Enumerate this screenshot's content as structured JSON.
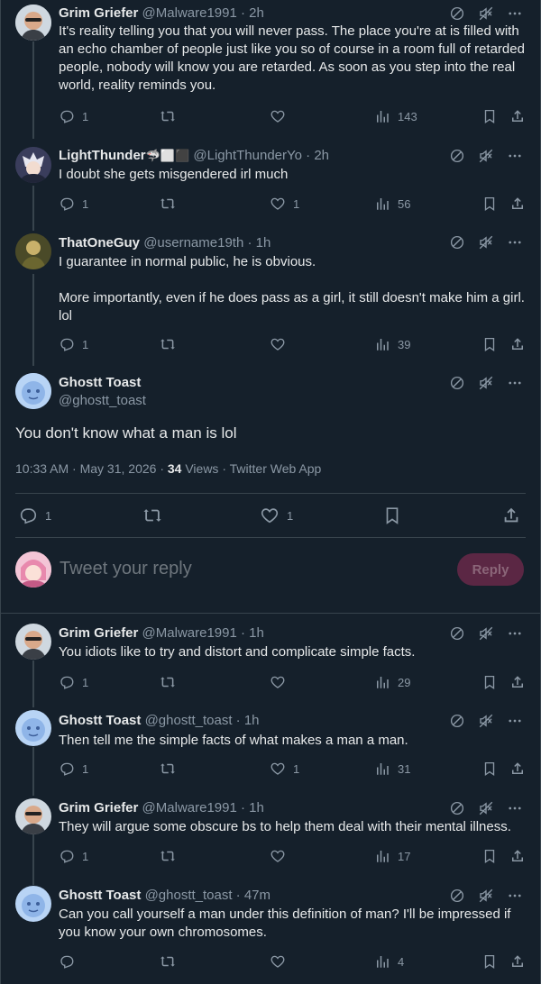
{
  "tweets_above": [
    {
      "name": "Grim Griefer",
      "handle": "@Malware1991 · 2h",
      "text": "It's reality telling you that you will never pass. The place you're at is filled with an echo chamber of people just like you so of course in a room full of retarded people, nobody will know you are retarded. As soon as you step into the real world, reality reminds you.",
      "replies": "1",
      "likes": "",
      "views": "143"
    },
    {
      "name": "LightThunder",
      "name_suffix": "🦈⬜⬛",
      "handle": "@LightThunderYo · 2h",
      "text": "I doubt she gets misgendered irl much",
      "replies": "1",
      "likes": "1",
      "views": "56"
    },
    {
      "name": "ThatOneGuy",
      "handle": "@username19th · 1h",
      "text": "I guarantee in normal public, he is obvious.\n\nMore importantly, even if he does pass as a girl, it still doesn't make him a girl. lol",
      "replies": "1",
      "likes": "",
      "views": "39"
    }
  ],
  "main_tweet": {
    "name": "Ghostt Toast",
    "handle": "@ghostt_toast",
    "text": "You don't know what a man is lol",
    "meta_prefix": "10:33 AM · May 31, 2026 · ",
    "views_count": "34",
    "meta_suffix": " Views · Twitter Web App",
    "replies": "1",
    "likes": "1"
  },
  "reply_composer": {
    "placeholder": "Tweet your reply",
    "button_label": "Reply"
  },
  "tweets_below": [
    {
      "name": "Grim Griefer",
      "handle": "@Malware1991 · 1h",
      "text": "You idiots like to try and distort and complicate simple facts.",
      "replies": "1",
      "likes": "",
      "views": "29"
    },
    {
      "name": "Ghostt Toast",
      "handle": "@ghostt_toast · 1h",
      "text": "Then tell me the simple facts of what makes a man a man.",
      "replies": "1",
      "likes": "1",
      "views": "31"
    },
    {
      "name": "Grim Griefer",
      "handle": "@Malware1991 · 1h",
      "text": "They will argue some obscure bs to help them deal with their mental illness.",
      "replies": "1",
      "likes": "",
      "views": "17"
    },
    {
      "name": "Ghostt Toast",
      "handle": "@ghostt_toast · 47m",
      "text": "Can you call yourself a man under this definition of man? I'll be impressed if you know your own chromosomes.",
      "replies": "",
      "likes": "",
      "views": "4"
    }
  ],
  "colors": {
    "background": "#15202b",
    "text": "#e7e9ea",
    "muted": "#8b98a5",
    "border": "#38444d",
    "reply_button_bg": "#5b2744"
  }
}
